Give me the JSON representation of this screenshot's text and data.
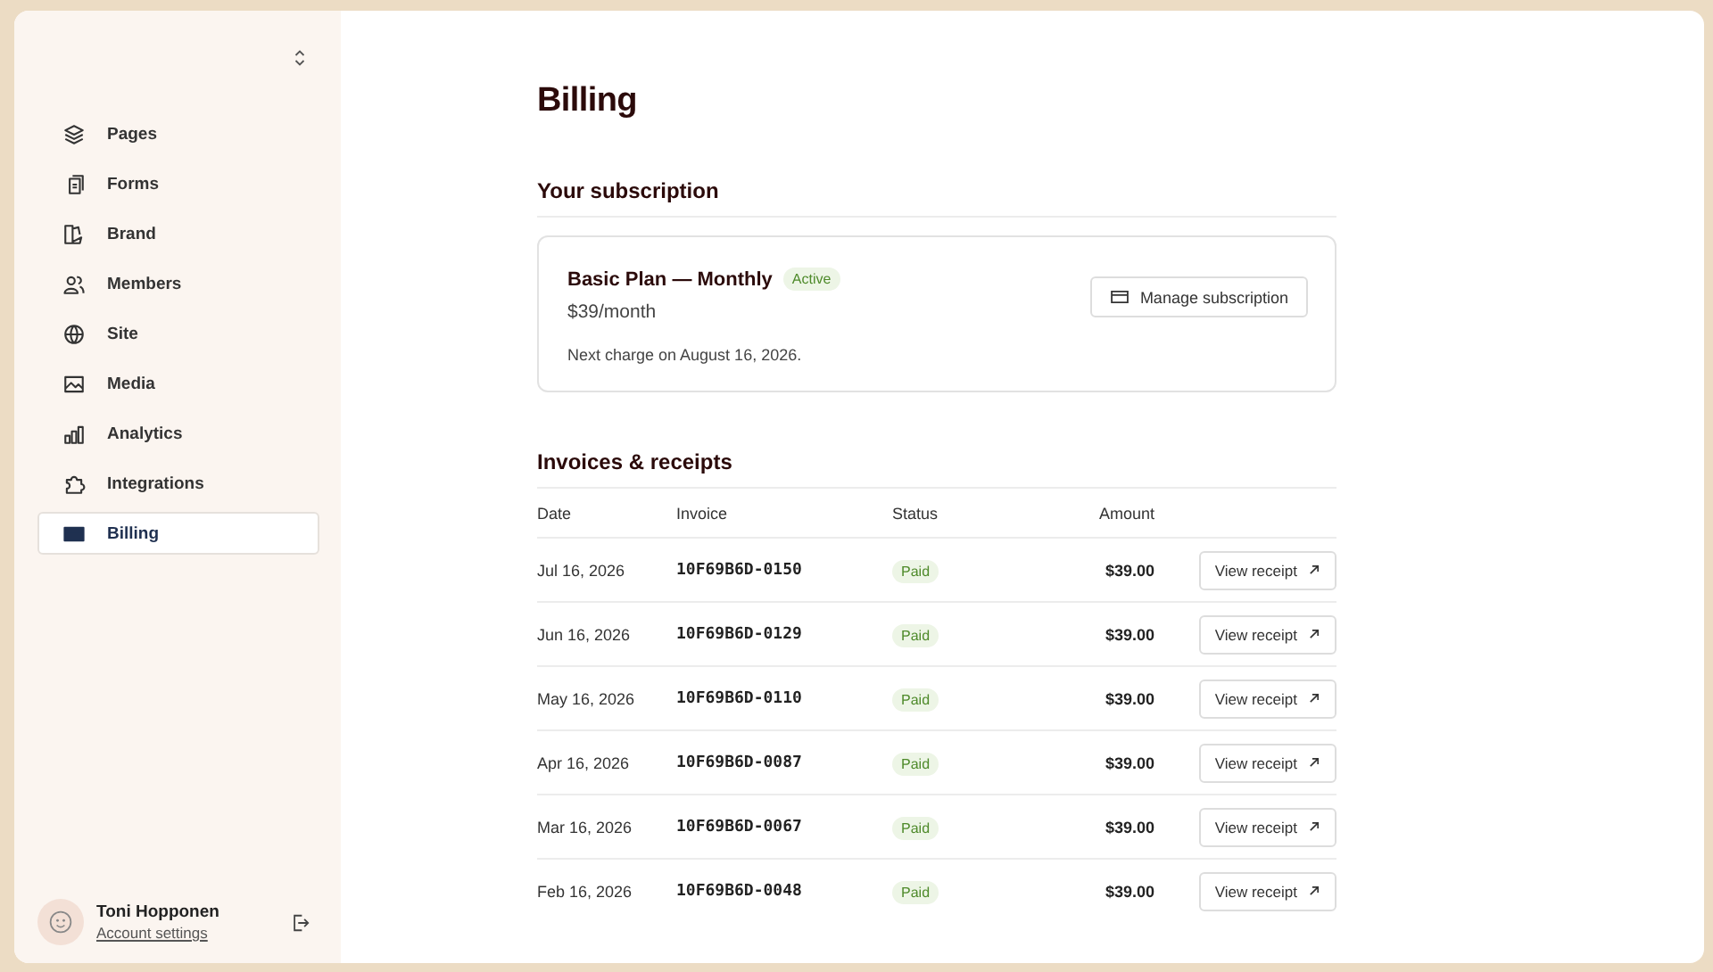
{
  "sidebar": {
    "items": [
      {
        "label": "Pages",
        "selected": false
      },
      {
        "label": "Forms",
        "selected": false
      },
      {
        "label": "Brand",
        "selected": false
      },
      {
        "label": "Members",
        "selected": false
      },
      {
        "label": "Site",
        "selected": false
      },
      {
        "label": "Media",
        "selected": false
      },
      {
        "label": "Analytics",
        "selected": false
      },
      {
        "label": "Integrations",
        "selected": false
      },
      {
        "label": "Billing",
        "selected": true
      }
    ],
    "user": {
      "name": "Toni Hopponen",
      "link": "Account settings"
    }
  },
  "page_title": "Billing",
  "subscription": {
    "heading": "Your subscription",
    "plan": "Basic Plan — Monthly",
    "badge": "Active",
    "price": "$39/month",
    "next_charge": "Next charge on August 16, 2026.",
    "button": "Manage subscription"
  },
  "invoices": {
    "heading": "Invoices & receipts",
    "columns": [
      "Date",
      "Invoice",
      "Status",
      "Amount"
    ],
    "rows": [
      {
        "date": "Jul 16, 2026",
        "invoice": "10F69B6D-0150",
        "status": "Paid",
        "amount": "$39.00",
        "action": "View receipt"
      },
      {
        "date": "Jun 16, 2026",
        "invoice": "10F69B6D-0129",
        "status": "Paid",
        "amount": "$39.00",
        "action": "View receipt"
      },
      {
        "date": "May 16, 2026",
        "invoice": "10F69B6D-0110",
        "status": "Paid",
        "amount": "$39.00",
        "action": "View receipt"
      },
      {
        "date": "Apr 16, 2026",
        "invoice": "10F69B6D-0087",
        "status": "Paid",
        "amount": "$39.00",
        "action": "View receipt"
      },
      {
        "date": "Mar 16, 2026",
        "invoice": "10F69B6D-0067",
        "status": "Paid",
        "amount": "$39.00",
        "action": "View receipt"
      },
      {
        "date": "Feb 16, 2026",
        "invoice": "10F69B6D-0048",
        "status": "Paid",
        "amount": "$39.00",
        "action": "View receipt"
      }
    ]
  }
}
